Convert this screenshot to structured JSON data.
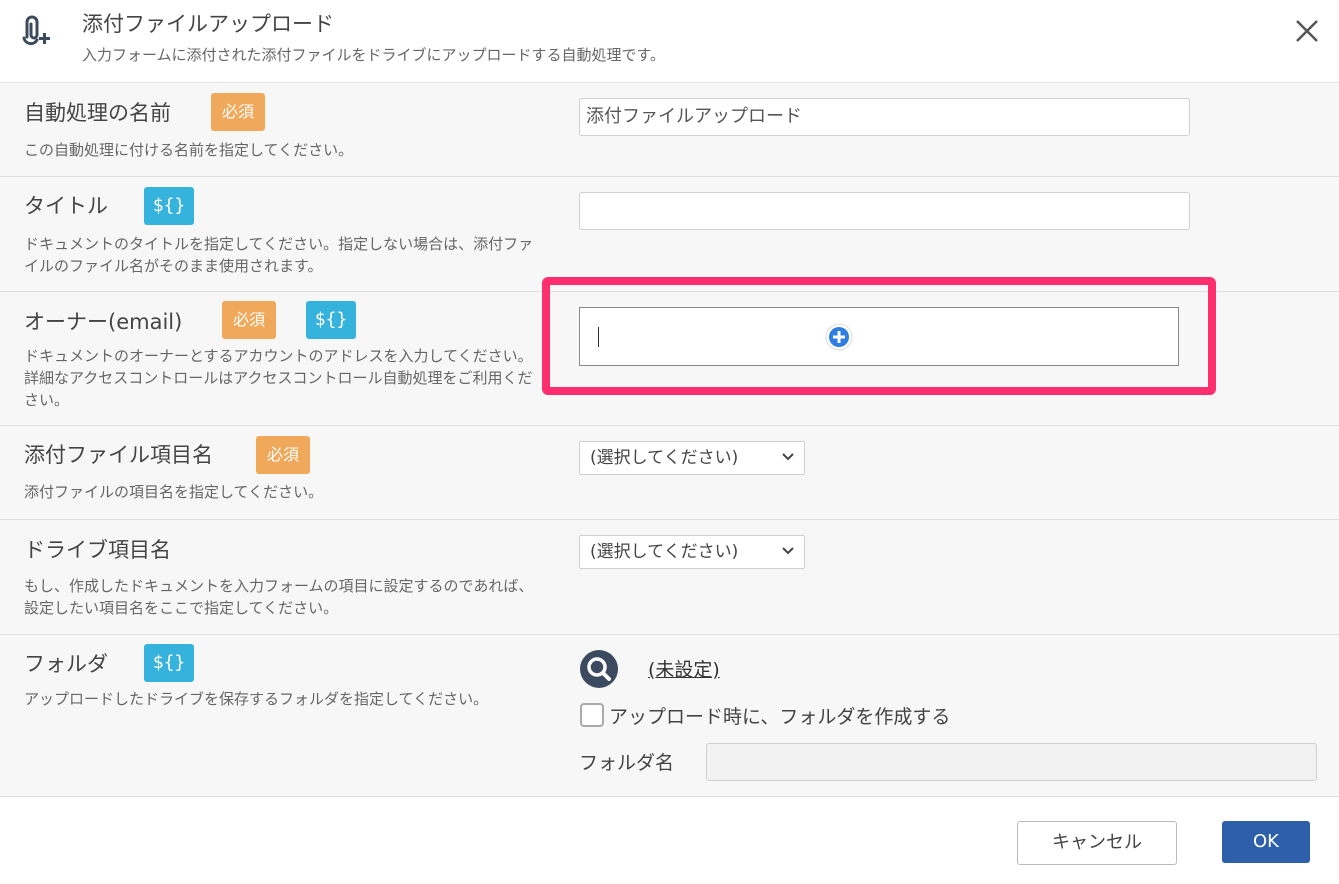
{
  "header": {
    "icon": "paperclip-plus-icon",
    "title": "添付ファイルアップロード",
    "subtitle": "入力フォームに添付された添付ファイルをドライブにアップロードする自動処理です。",
    "close_icon": "close-icon"
  },
  "badges": {
    "required": "必須",
    "variable": "${}"
  },
  "fields": {
    "name": {
      "label": "自動処理の名前",
      "description": "この自動処理に付ける名前を指定してください。",
      "value": "添付ファイルアップロード"
    },
    "title": {
      "label": "タイトル",
      "description": "ドキュメントのタイトルを指定してください。指定しない場合は、添付ファイルのファイル名がそのまま使用されます。",
      "value": ""
    },
    "owner": {
      "label": "オーナー(email)",
      "description": "ドキュメントのオーナーとするアカウントのアドレスを入力してください。詳細なアクセスコントロールはアクセスコントロール自動処理をご利用ください。",
      "value": ""
    },
    "attachment_field": {
      "label": "添付ファイル項目名",
      "description": "添付ファイルの項目名を指定してください。",
      "selected": "(選択してください)"
    },
    "drive_field": {
      "label": "ドライブ項目名",
      "description": "もし、作成したドキュメントを入力フォームの項目に設定するのであれば、設定したい項目名をここで指定してください。",
      "selected": "(選択してください)"
    },
    "folder": {
      "label": "フォルダ",
      "description": "アップロードしたドライブを保存するフォルダを指定してください。",
      "link": "(未設定)",
      "create_checkbox_label": "アップロード時に、フォルダを作成する",
      "folder_name_label": "フォルダ名",
      "folder_name_value": ""
    }
  },
  "footer": {
    "cancel_label": "キャンセル",
    "ok_label": "OK"
  },
  "colors": {
    "accent_highlight": "#ff2e6e",
    "required_badge": "#f0a95b",
    "variable_badge": "#36b3dd",
    "primary_button": "#2d5fab"
  }
}
